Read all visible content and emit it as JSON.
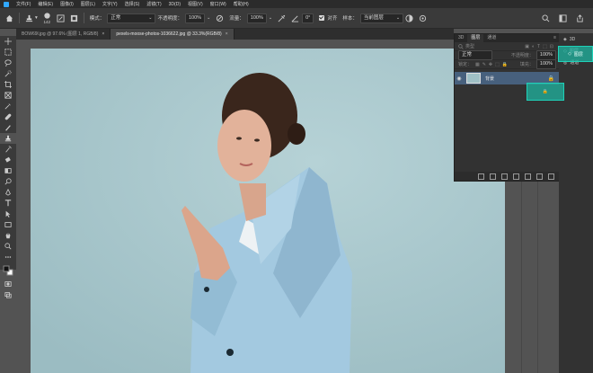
{
  "menu": [
    "文件(F)",
    "编辑(E)",
    "图像(I)",
    "图层(L)",
    "文字(Y)",
    "选择(S)",
    "滤镜(T)",
    "3D(D)",
    "视图(V)",
    "窗口(W)",
    "帮助(H)"
  ],
  "options": {
    "brush_size": "142",
    "mode_label": "模式：",
    "mode_value": "正常",
    "opacity_label": "不透明度：",
    "opacity_value": "100%",
    "flow_label": "流量：",
    "flow_value": "100%",
    "angle_value": "0°",
    "align_label": "对齐",
    "sample_label": "样本：",
    "sample_value": "当前图层"
  },
  "tabs": [
    {
      "label": "BOW69l.jpg @ 97.6% (图层 1, RGB/8)"
    },
    {
      "label": "pexels-moose-photos-1036622.jpg @ 33.3%(RGB/8)"
    }
  ],
  "panel": {
    "tabs": [
      "3D",
      "图层",
      "通道"
    ],
    "kind_label": "类型",
    "blend_label": "正常",
    "opacity_label": "不透明度：",
    "opacity_value": "100%",
    "lock_label": "锁定：",
    "fill_label": "填充：",
    "fill_value": "100%",
    "layer_name": "背景"
  },
  "dock": {
    "items": [
      "3D",
      "图层",
      "通道"
    ],
    "highlight_label": "图层"
  },
  "colors": {
    "accent": "#31a8ff",
    "highlight": "#1fb4a0",
    "canvas_bg": "#a8c6cb"
  }
}
